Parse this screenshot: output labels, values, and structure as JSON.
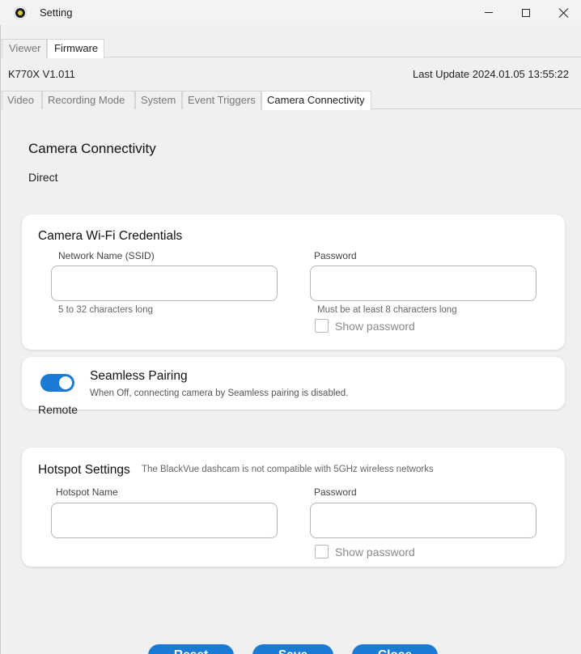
{
  "window": {
    "title": "Setting",
    "icon": "blackvue-logo-icon"
  },
  "top_tabs": [
    {
      "label": "Viewer",
      "active": false
    },
    {
      "label": "Firmware",
      "active": true
    }
  ],
  "firmware": {
    "model": "K770X V1.011",
    "last_update": "Last Update 2024.01.05 13:55:22"
  },
  "sub_tabs": [
    {
      "label": "Video",
      "active": false
    },
    {
      "label": "Recording Mode",
      "active": false
    },
    {
      "label": "System",
      "active": false
    },
    {
      "label": "Event Triggers",
      "active": false
    },
    {
      "label": "Camera Connectivity",
      "active": true
    }
  ],
  "page": {
    "heading": "Camera Connectivity",
    "direct_label": "Direct",
    "remote_label": "Remote"
  },
  "wifi": {
    "title": "Camera Wi-Fi Credentials",
    "ssid_label": "Network Name (SSID)",
    "ssid_value": "",
    "ssid_hint": "5 to 32 characters long",
    "password_label": "Password",
    "password_value": "",
    "password_hint": "Must be at least 8 characters long",
    "show_password_label": "Show password",
    "show_password_checked": false
  },
  "seamless": {
    "title": "Seamless Pairing",
    "description": "When Off, connecting camera by Seamless pairing is disabled.",
    "enabled": true,
    "accent_color": "#1a7bd4"
  },
  "hotspot": {
    "title": "Hotspot Settings",
    "note": "The BlackVue dashcam is not compatible with 5GHz wireless networks",
    "name_label": "Hotspot Name",
    "name_value": "",
    "password_label": "Password",
    "password_value": "",
    "show_password_label": "Show password",
    "show_password_checked": false
  },
  "buttons": {
    "reset": "Reset",
    "save": "Save",
    "close": "Close"
  }
}
